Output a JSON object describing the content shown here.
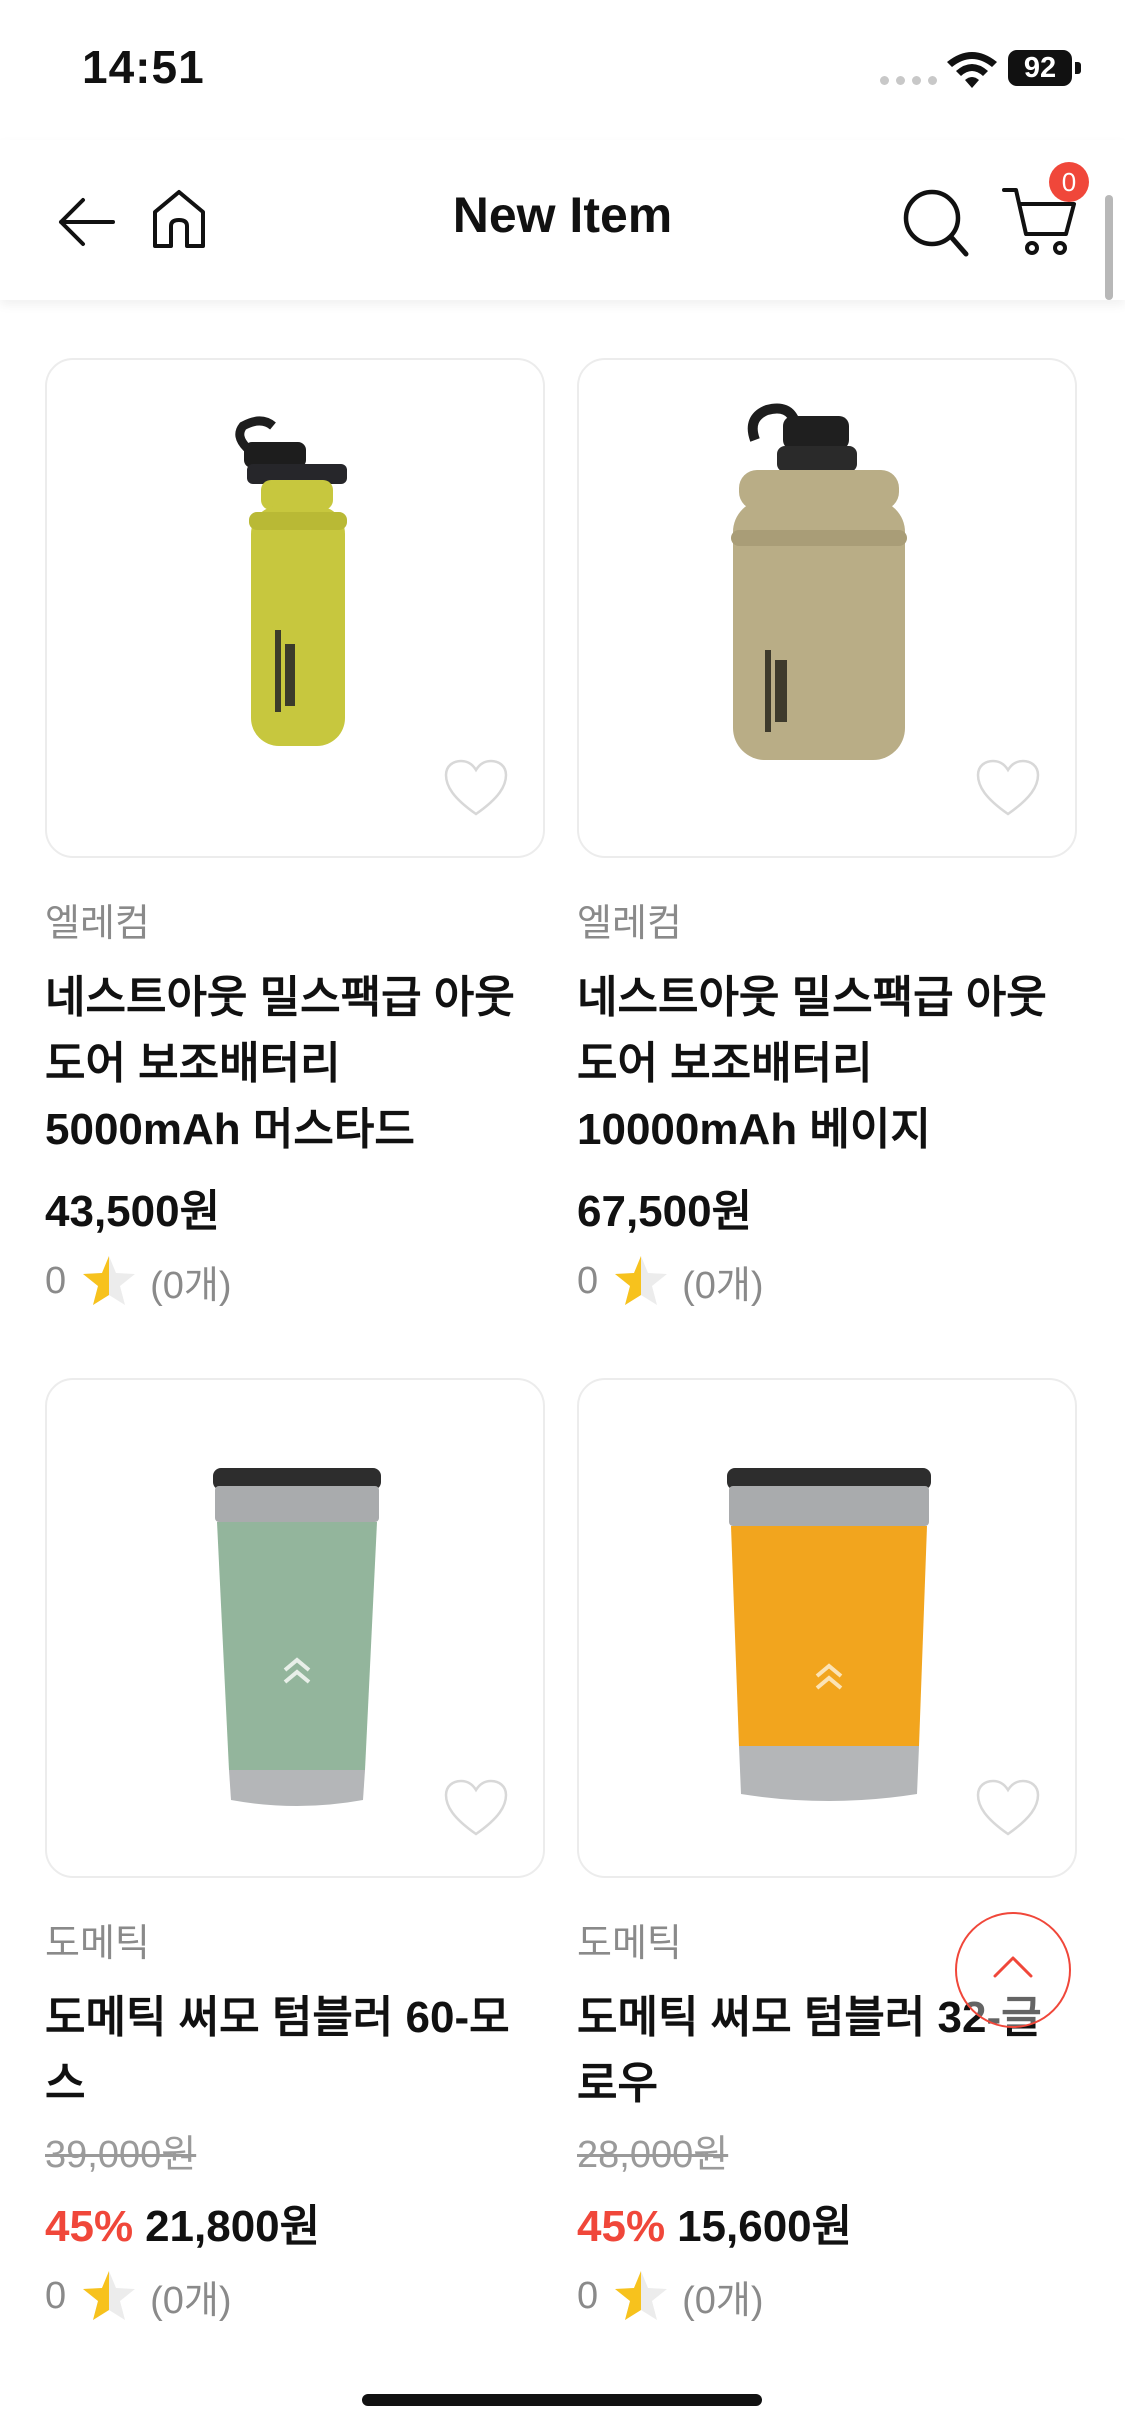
{
  "status_bar": {
    "time": "14:51",
    "battery": "92"
  },
  "nav": {
    "title": "New Item",
    "cart_count": "0"
  },
  "products": [
    {
      "brand": "엘레컴",
      "name": "네스트아웃 밀스팩급 아웃도어 보조배터리 5000mAh 머스타드",
      "price": "43,500원",
      "rating": "0",
      "review_count": "(0개)"
    },
    {
      "brand": "엘레컴",
      "name": "네스트아웃 밀스팩급 아웃도어 보조배터리 10000mAh 베이지",
      "price": "67,500원",
      "rating": "0",
      "review_count": "(0개)"
    },
    {
      "brand": "도메틱",
      "name": "도메틱 써모 텀블러 60-모스",
      "original_price": "39,000원",
      "discount": "45%",
      "price": "21,800원",
      "rating": "0",
      "review_count": "(0개)"
    },
    {
      "brand": "도메틱",
      "name": "도메틱 써모 텀블러 32-글로우",
      "original_price": "28,000원",
      "discount": "45%",
      "price": "15,600원",
      "rating": "0",
      "review_count": "(0개)"
    }
  ],
  "colors": {
    "accent": "#f0473a",
    "star": "#f7c21d",
    "mustard": "#c7c73e",
    "beige": "#b9ad86",
    "moss": "#93b59c",
    "glow": "#f2a51e"
  }
}
